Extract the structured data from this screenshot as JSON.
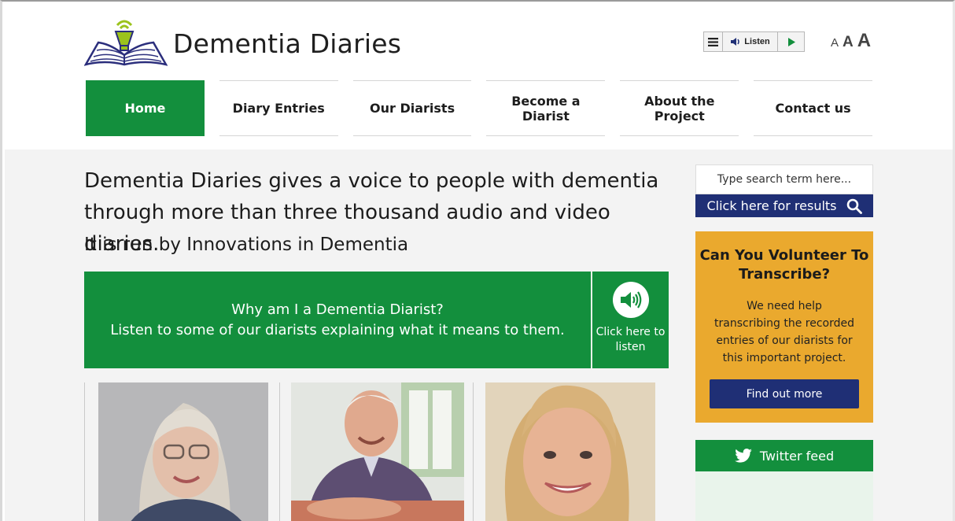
{
  "header": {
    "site_title": "Dementia Diaries",
    "listen_widget": {
      "label": "Listen"
    },
    "text_size": {
      "small": "A",
      "medium": "A",
      "large": "A"
    }
  },
  "nav": {
    "items": [
      {
        "label": "Home",
        "active": true
      },
      {
        "label": "Diary Entries"
      },
      {
        "label": "Our Diarists"
      },
      {
        "label": "Become a Diarist"
      },
      {
        "label": "About the Project"
      },
      {
        "label": "Contact us"
      }
    ]
  },
  "intro": {
    "headline": "Dementia Diaries gives a voice to people with dementia through more than three thousand audio and video diaries.",
    "subline": "It is run by Innovations in Dementia"
  },
  "banner": {
    "line1": "Why am I a Dementia Diarist?",
    "line2": "Listen to some of our diarists explaining what it means to them.",
    "listen_label": "Click here to listen"
  },
  "sidebar": {
    "search": {
      "placeholder": "Type search term here...",
      "button_label": "Click here for results"
    },
    "volunteer": {
      "title": "Can You Volunteer To Transcribe?",
      "body": "We need help transcribing the recorded entries of our diarists for this important project.",
      "button_label": "Find out more"
    },
    "twitter": {
      "label": "Twitter feed"
    }
  },
  "colors": {
    "brand_green": "#138f3d",
    "navy": "#1f2f75",
    "volunteer_orange": "#eaa92e",
    "logo_lime": "#9bc31c"
  }
}
